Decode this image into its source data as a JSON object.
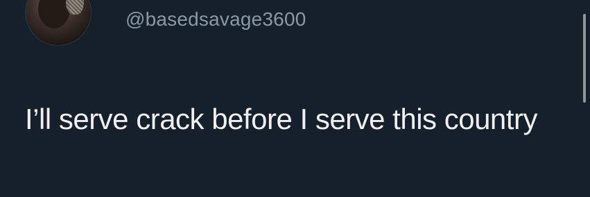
{
  "tweet": {
    "handle": "@basedsavage3600",
    "text": "I’ll serve crack before I serve this country"
  },
  "colors": {
    "background": "#15202b",
    "text": "#eef0f2",
    "handle": "#8b98a5"
  }
}
